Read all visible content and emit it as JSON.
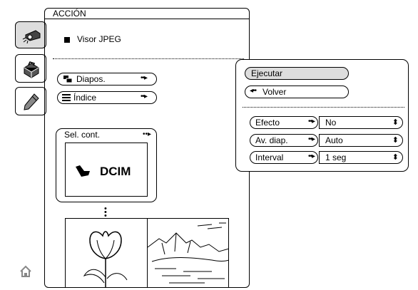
{
  "panel": {
    "title": "ACCIÓN"
  },
  "visor": {
    "label": "Visor JPEG"
  },
  "menu": {
    "diapos": {
      "label": "Diapos.",
      "arrow": "••▸"
    },
    "indice": {
      "label": "Índice",
      "arrow": "••▸"
    }
  },
  "sel_cont": {
    "label": "Sel. cont.",
    "arrow": "••▸",
    "folder": "DCIM"
  },
  "popup": {
    "ejecutar": {
      "label": "Ejecutar"
    },
    "volver": {
      "label": "Volver",
      "arrow": "◂••"
    },
    "options": [
      {
        "label": "Efecto",
        "arrow": "••▸",
        "value": "No"
      },
      {
        "label": "Av. diap.",
        "arrow": "••▸",
        "value": "Auto"
      },
      {
        "label": "Interval",
        "arrow": "••▸",
        "value": "1 seg"
      }
    ],
    "updown_glyph": "⬍"
  },
  "icons": {
    "tab1": "projector-icon",
    "tab2": "toolbox-icon",
    "tab3": "pencil-icon",
    "home": "home-icon",
    "dcim": "folder-icon"
  }
}
